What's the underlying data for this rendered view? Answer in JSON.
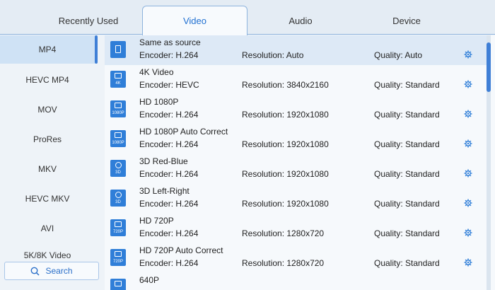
{
  "tabs": [
    {
      "label": "Recently Used",
      "active": false
    },
    {
      "label": "Video",
      "active": true
    },
    {
      "label": "Audio",
      "active": false
    },
    {
      "label": "Device",
      "active": false
    }
  ],
  "sidebar": {
    "items": [
      {
        "label": "MP4",
        "active": true
      },
      {
        "label": "HEVC MP4",
        "active": false
      },
      {
        "label": "MOV",
        "active": false
      },
      {
        "label": "ProRes",
        "active": false
      },
      {
        "label": "MKV",
        "active": false
      },
      {
        "label": "HEVC MKV",
        "active": false
      },
      {
        "label": "AVI",
        "active": false
      },
      {
        "label": "5K/8K Video",
        "active": false
      }
    ],
    "search_label": "Search"
  },
  "presets": [
    {
      "name": "Same as source",
      "encoder": "Encoder: H.264",
      "resolution": "Resolution: Auto",
      "quality": "Quality: Auto",
      "badge": "",
      "icon": "copy-icon",
      "selected": true
    },
    {
      "name": "4K Video",
      "encoder": "Encoder: HEVC",
      "resolution": "Resolution: 3840x2160",
      "quality": "Quality: Standard",
      "badge": "4K",
      "icon": "film-icon",
      "selected": false
    },
    {
      "name": "HD 1080P",
      "encoder": "Encoder: H.264",
      "resolution": "Resolution: 1920x1080",
      "quality": "Quality: Standard",
      "badge": "1080P",
      "icon": "film-icon",
      "selected": false
    },
    {
      "name": "HD 1080P Auto Correct",
      "encoder": "Encoder: H.264",
      "resolution": "Resolution: 1920x1080",
      "quality": "Quality: Standard",
      "badge": "1080P",
      "icon": "film-icon",
      "selected": false
    },
    {
      "name": "3D Red-Blue",
      "encoder": "Encoder: H.264",
      "resolution": "Resolution: 1920x1080",
      "quality": "Quality: Standard",
      "badge": "3D",
      "icon": "3d-icon",
      "selected": false
    },
    {
      "name": "3D Left-Right",
      "encoder": "Encoder: H.264",
      "resolution": "Resolution: 1920x1080",
      "quality": "Quality: Standard",
      "badge": "3D",
      "icon": "3d-icon",
      "selected": false
    },
    {
      "name": "HD 720P",
      "encoder": "Encoder: H.264",
      "resolution": "Resolution: 1280x720",
      "quality": "Quality: Standard",
      "badge": "720P",
      "icon": "film-icon",
      "selected": false
    },
    {
      "name": "HD 720P Auto Correct",
      "encoder": "Encoder: H.264",
      "resolution": "Resolution: 1280x720",
      "quality": "Quality: Standard",
      "badge": "720P",
      "icon": "film-icon",
      "selected": false
    },
    {
      "name": "640P",
      "encoder": "",
      "resolution": "",
      "quality": "",
      "badge": "",
      "icon": "film-icon",
      "selected": false
    }
  ],
  "colors": {
    "accent": "#2f7ed8",
    "selected_row": "#dde9f6",
    "sidebar_active": "#cfe2f5"
  }
}
